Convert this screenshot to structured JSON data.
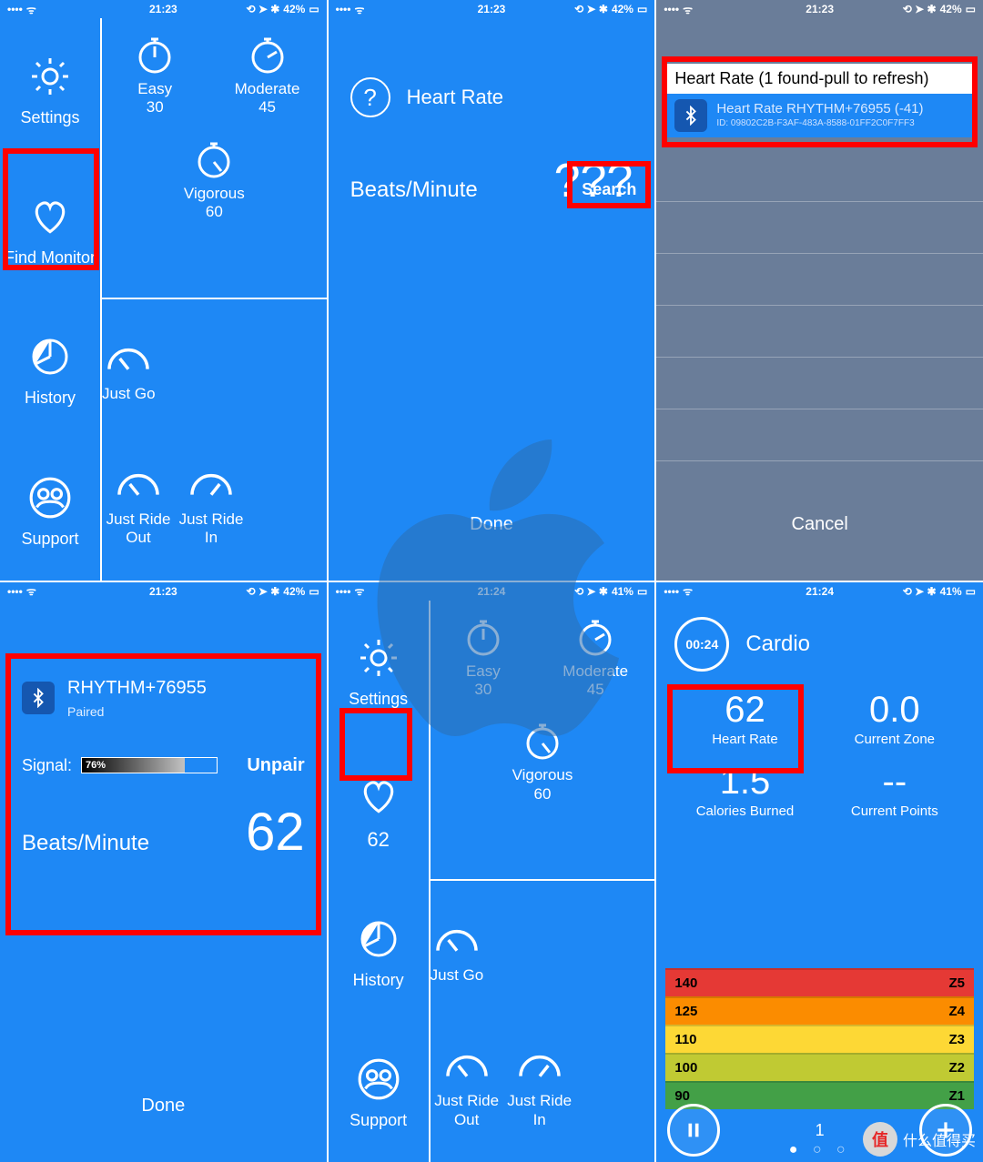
{
  "status": {
    "time_a": "21:23",
    "time_b": "21:24",
    "battery_a": "42%",
    "battery_b": "41%",
    "loc": "⟲",
    "nav": "➤",
    "bt": "✱"
  },
  "panel1": {
    "sidebar": {
      "settings": "Settings",
      "findmon": "Find Monitor",
      "history": "History",
      "support": "Support"
    },
    "tiles": {
      "easy": "Easy",
      "easy_n": "30",
      "mod": "Moderate",
      "mod_n": "45",
      "vig": "Vigorous",
      "vig_n": "60",
      "justgo": "Just Go",
      "rideout": "Just Ride Out",
      "ridein": "Just Ride In"
    }
  },
  "panel2": {
    "title": "Heart Rate",
    "search": "Search",
    "bpm_lbl": "Beats/Minute",
    "bpm_val": "???",
    "done": "Done"
  },
  "panel3": {
    "header": "Heart Rate (1 found-pull to refresh)",
    "dev": "Heart Rate RHYTHM+76955 (-41)",
    "devid": "ID: 09802C2B-F3AF-483A-8588-01FF2C0F7FF3",
    "cancel": "Cancel"
  },
  "panel4": {
    "dev": "RHYTHM+76955",
    "paired": "Paired",
    "signal_lbl": "Signal:",
    "signal_pct": "76%",
    "unpair": "Unpair",
    "bpm_lbl": "Beats/Minute",
    "bpm_val": "62",
    "done": "Done"
  },
  "panel5": {
    "hr": "62"
  },
  "panel6": {
    "timer": "00:24",
    "title": "Cardio",
    "hr_val": "62",
    "hr_lbl": "Heart Rate",
    "zone_val": "0.0",
    "zone_lbl": "Current Zone",
    "cal_val": "1.5",
    "cal_lbl": "Calories Burned",
    "pts_val": "--",
    "pts_lbl": "Current Points",
    "page": "1",
    "zones": [
      {
        "v": "140",
        "z": "Z5",
        "c": "#e53935"
      },
      {
        "v": "125",
        "z": "Z4",
        "c": "#fb8c00"
      },
      {
        "v": "110",
        "z": "Z3",
        "c": "#fdd835"
      },
      {
        "v": "100",
        "z": "Z2",
        "c": "#c0ca33"
      },
      {
        "v": "90",
        "z": "Z1",
        "c": "#43a047"
      }
    ]
  },
  "watermark": "什么值得买"
}
